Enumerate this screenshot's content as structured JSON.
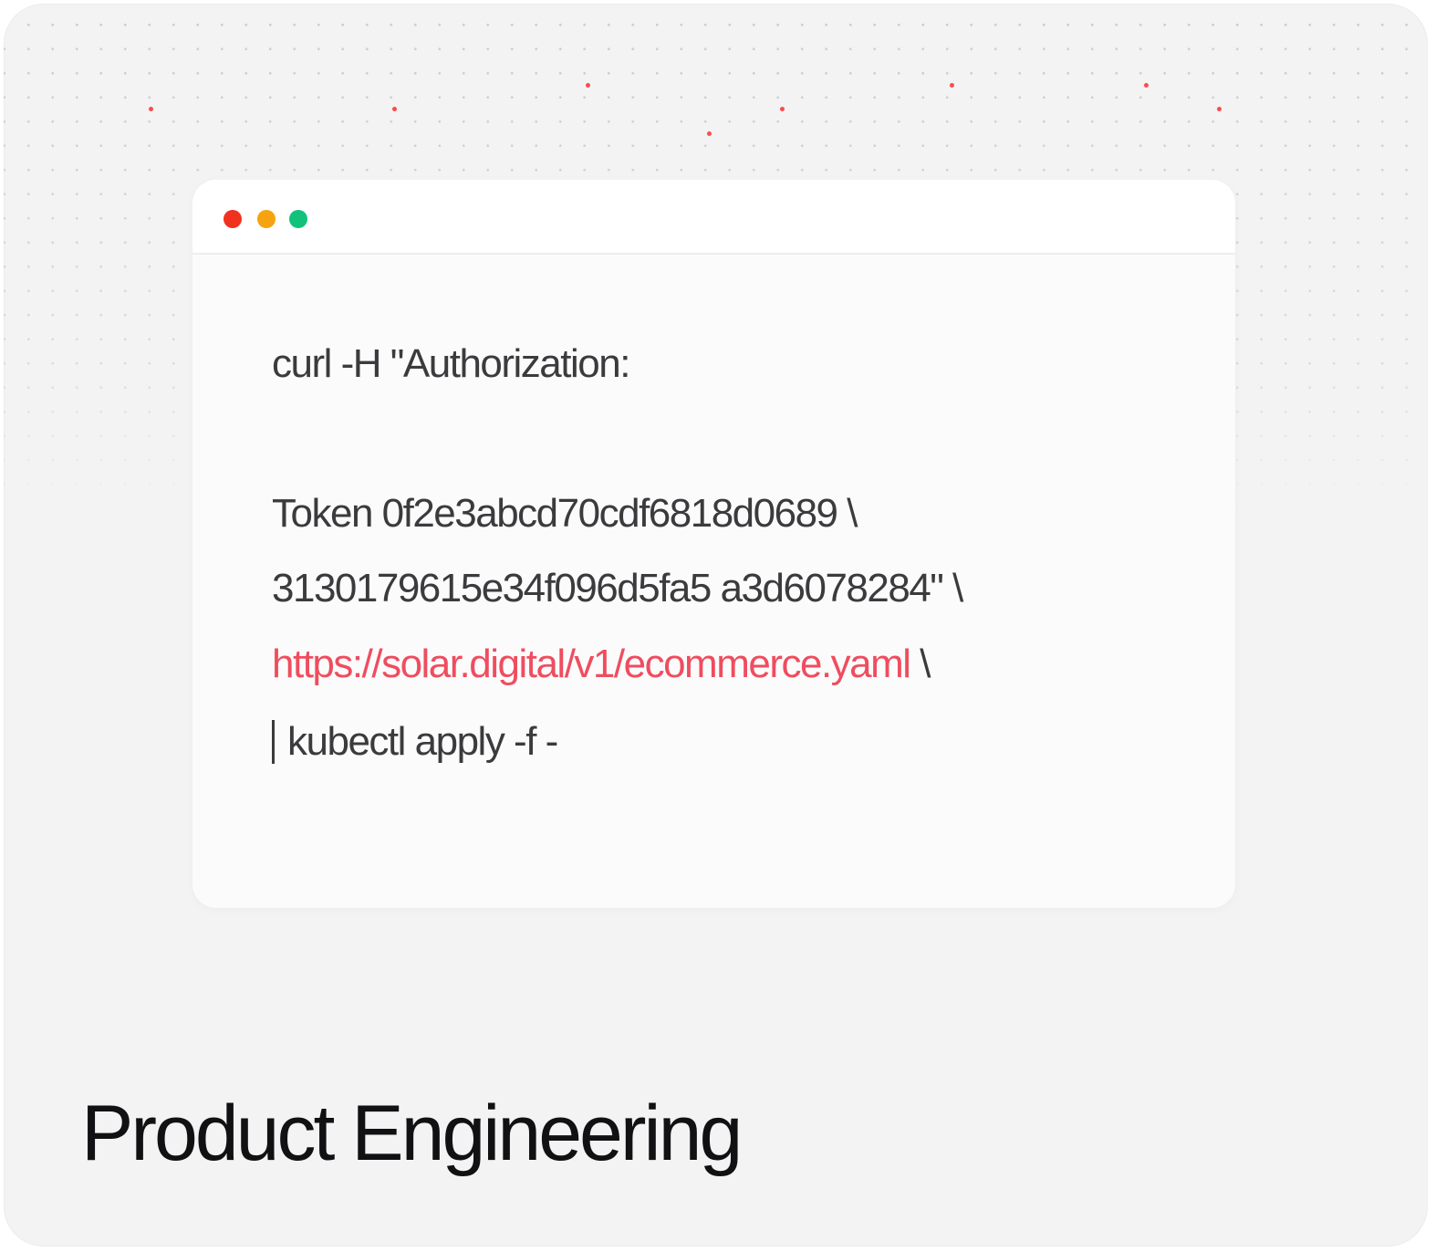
{
  "window": {
    "controls": [
      {
        "name": "close",
        "color": "#f0321e"
      },
      {
        "name": "minimize",
        "color": "#f5a30f"
      },
      {
        "name": "maximize",
        "color": "#13c27a"
      }
    ]
  },
  "code": {
    "line1": "curl -H \"Authorization:",
    "line2": "Token 0f2e3abcd70cdf6818d0689 \\",
    "line3": "3130179615e34f096d5fa5 a3d6078284\" \\",
    "line4_url": "https://solar.digital/v1/ecommerce.yaml",
    "line4_suffix": " \\",
    "line5": "kubectl apply -f -"
  },
  "heading": "Product Engineering",
  "colors": {
    "card_background": "#f3f3f4",
    "url": "#ef4d5e",
    "accent_dots": "#ff4a4a"
  }
}
